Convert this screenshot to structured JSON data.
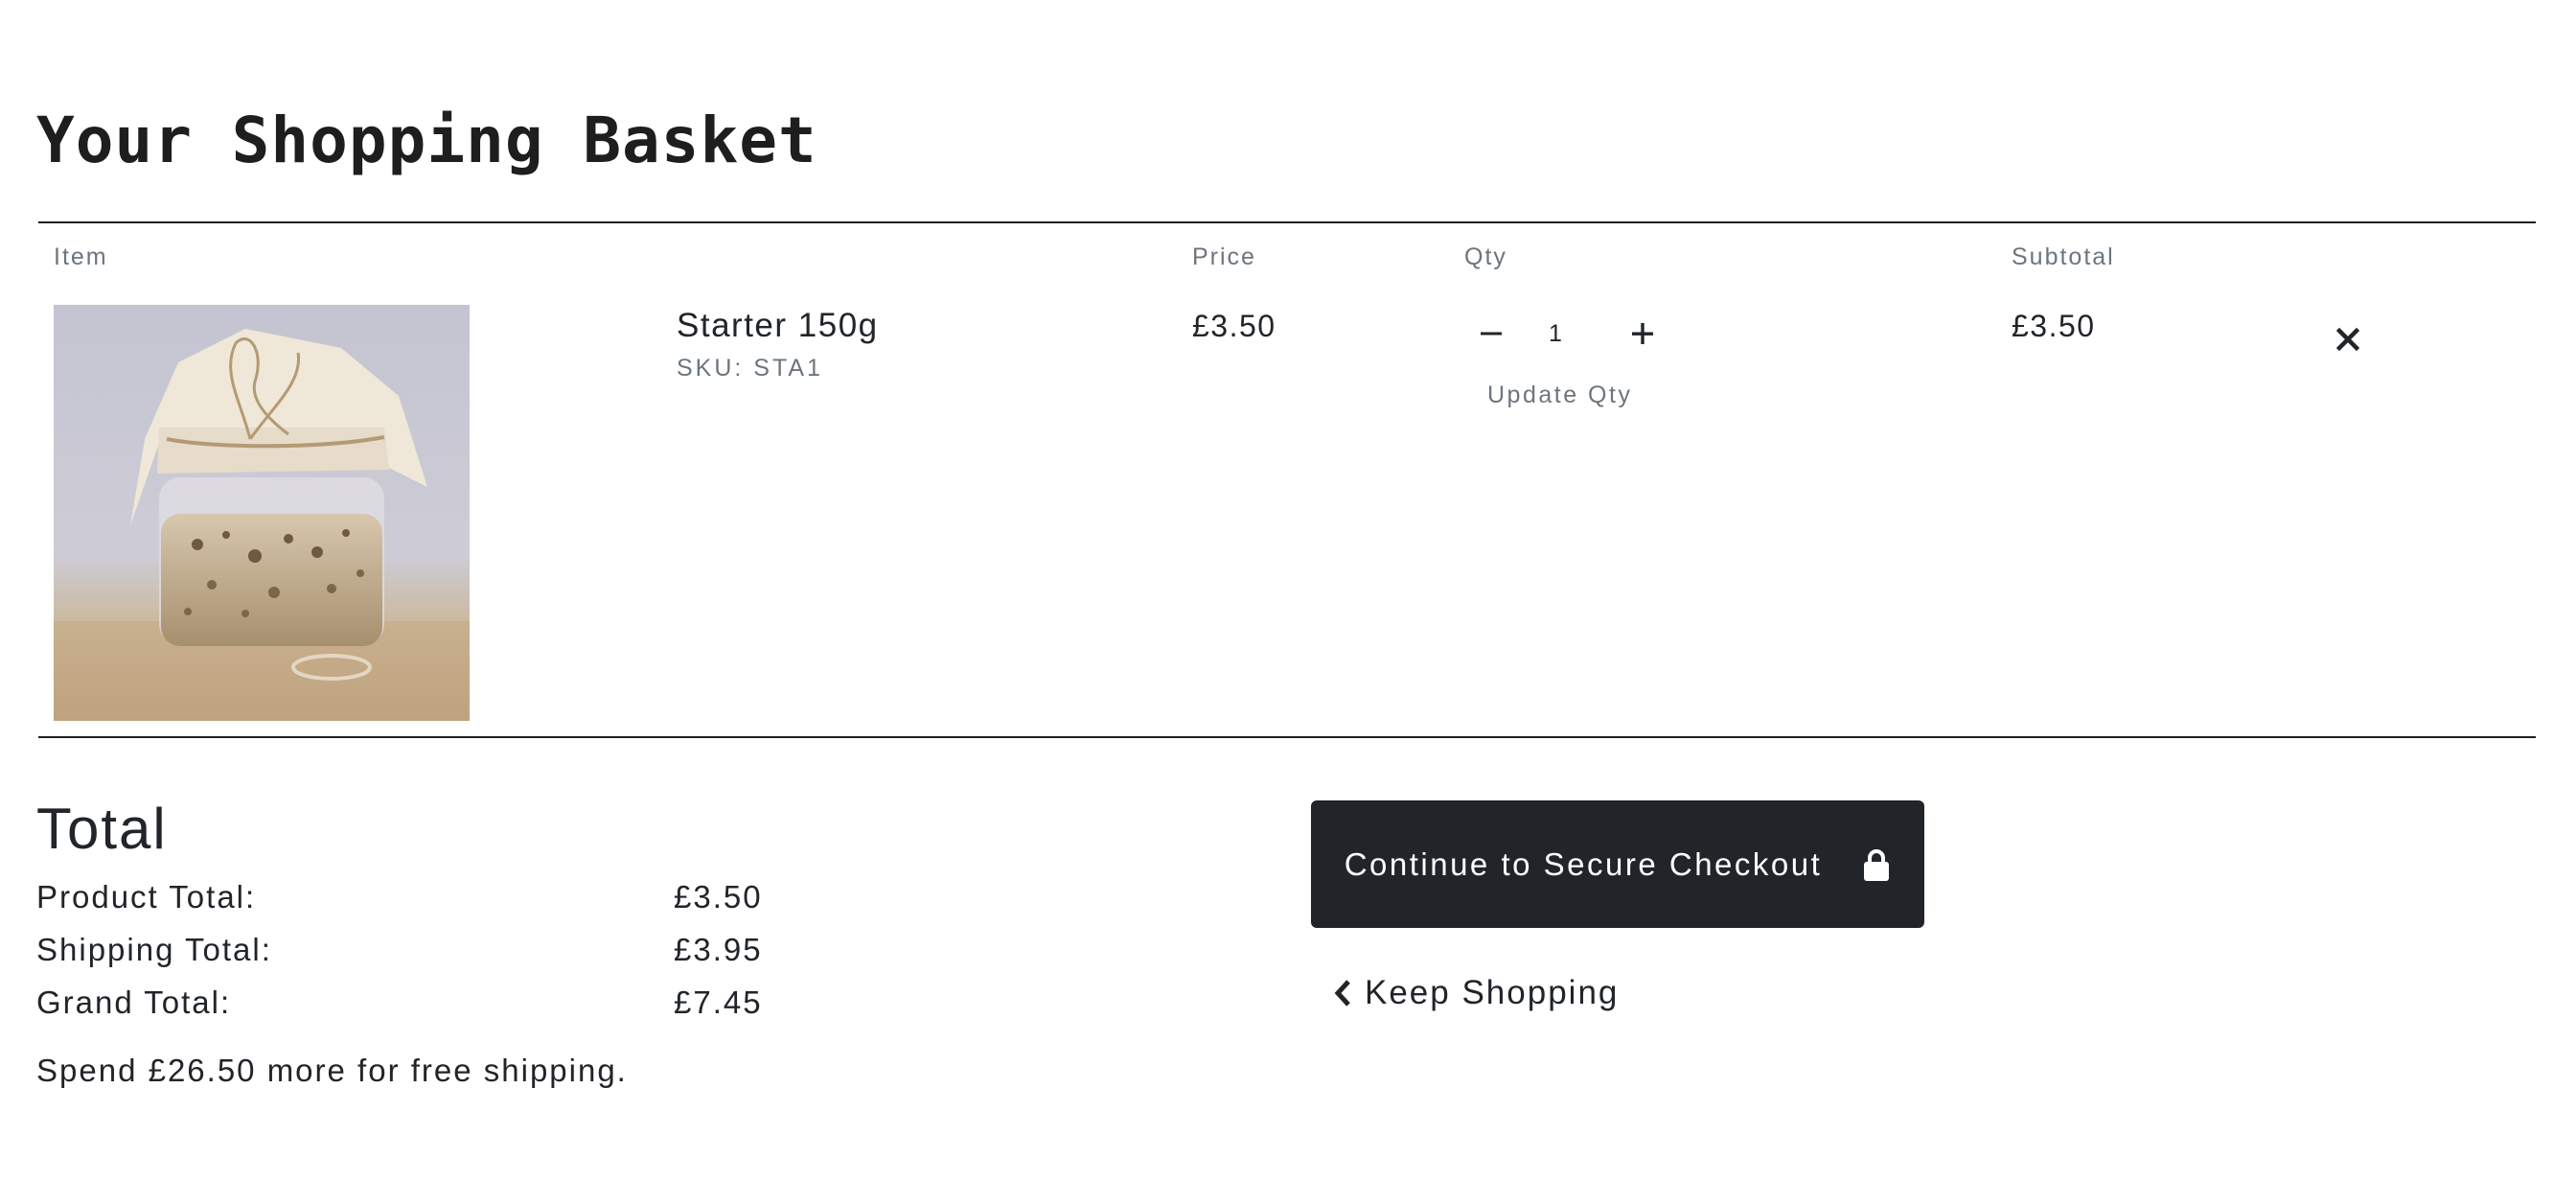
{
  "page": {
    "title": "Your Shopping Basket"
  },
  "table": {
    "headers": {
      "item": "Item",
      "price": "Price",
      "qty": "Qty",
      "subtotal": "Subtotal"
    }
  },
  "items": [
    {
      "name": "Starter 150g",
      "sku": "SKU: STA1",
      "price": "£3.50",
      "qty": "1",
      "update_label": "Update Qty",
      "subtotal": "£3.50",
      "image_icon": "sourdough-starter-jar-photo",
      "decrease_icon": "minus-icon",
      "increase_icon": "plus-icon",
      "remove_icon": "close-icon"
    }
  ],
  "totals": {
    "heading": "Total",
    "product_label": "Product Total:",
    "product_value": "£3.50",
    "shipping_label": "Shipping Total:",
    "shipping_value": "£3.95",
    "grand_label": "Grand Total:",
    "grand_value": "£7.45",
    "free_shipping_note": "Spend £26.50 more for free shipping."
  },
  "actions": {
    "checkout_label": "Continue to Secure Checkout",
    "checkout_icon": "lock-icon",
    "keep_shopping_label": "Keep Shopping",
    "keep_shopping_icon": "chevron-left-icon"
  },
  "colors": {
    "text": "#212529",
    "muted": "#6c757d",
    "button_bg": "#212529",
    "button_text": "#ffffff"
  }
}
